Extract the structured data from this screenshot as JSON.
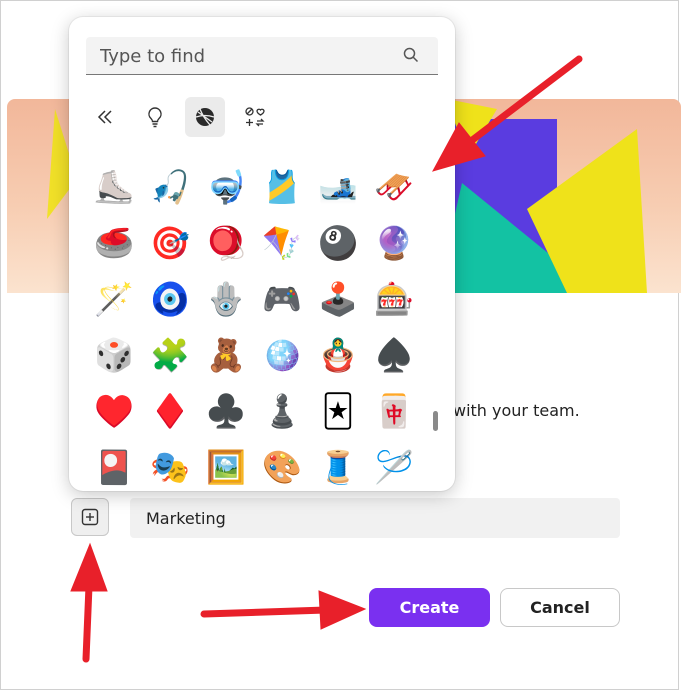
{
  "picker": {
    "search": {
      "placeholder": "Type to find",
      "value": ""
    },
    "categories": [
      {
        "icon": "double-chevron-left-icon",
        "active": false
      },
      {
        "icon": "lightbulb-icon",
        "active": false
      },
      {
        "icon": "basketball-icon",
        "active": true
      },
      {
        "icon": "symbols-icon",
        "active": false
      }
    ],
    "emoji_rows": [
      [
        "⛸️",
        "🎣",
        "🤿",
        "🎽",
        "🎿",
        "🛷"
      ],
      [
        "🥌",
        "🎯",
        "🪀",
        "🪁",
        "🎱",
        "🔮"
      ],
      [
        "🪄",
        "🧿",
        "🪬",
        "🎮",
        "🕹️",
        "🎰"
      ],
      [
        "🎲",
        "🧩",
        "🧸",
        "🪩",
        "🪆",
        "♠️"
      ],
      [
        "♥️",
        "♦️",
        "♣️",
        "♟️",
        "🃏",
        "🀄"
      ],
      [
        "🎴",
        "🎭",
        "🖼️",
        "🎨",
        "🧵",
        "🪡"
      ]
    ],
    "emoji_names": [
      [
        "ice-skate",
        "fishing-pole",
        "diving-mask",
        "running-shirt",
        "skis",
        "sled"
      ],
      [
        "curling-stone",
        "direct-hit",
        "yo-yo",
        "kite",
        "pool-8-ball",
        "crystal-ball"
      ],
      [
        "magic-wand",
        "nazar-amulet",
        "hamsa",
        "video-game",
        "joystick",
        "slot-machine"
      ],
      [
        "game-die",
        "puzzle-piece",
        "teddy-bear",
        "mirror-ball",
        "nesting-dolls",
        "spade-suit"
      ],
      [
        "heart-suit",
        "diamond-suit",
        "club-suit",
        "chess-pawn",
        "joker",
        "mahjong-red-dragon"
      ],
      [
        "flower-playing-cards",
        "performing-arts",
        "framed-picture",
        "artist-palette",
        "thread",
        "sewing-needle"
      ]
    ]
  },
  "form": {
    "helper_text": "with your team.",
    "name_value": "Marketing",
    "add_emoji_icon": "plus-square-icon"
  },
  "buttons": {
    "create": "Create",
    "cancel": "Cancel"
  },
  "colors": {
    "accent": "#7a30f0",
    "annotation_arrow": "#e8202a",
    "banner_yellow": "#efe21a",
    "banner_purple": "#5a3ce0",
    "banner_teal": "#13c2a3"
  }
}
